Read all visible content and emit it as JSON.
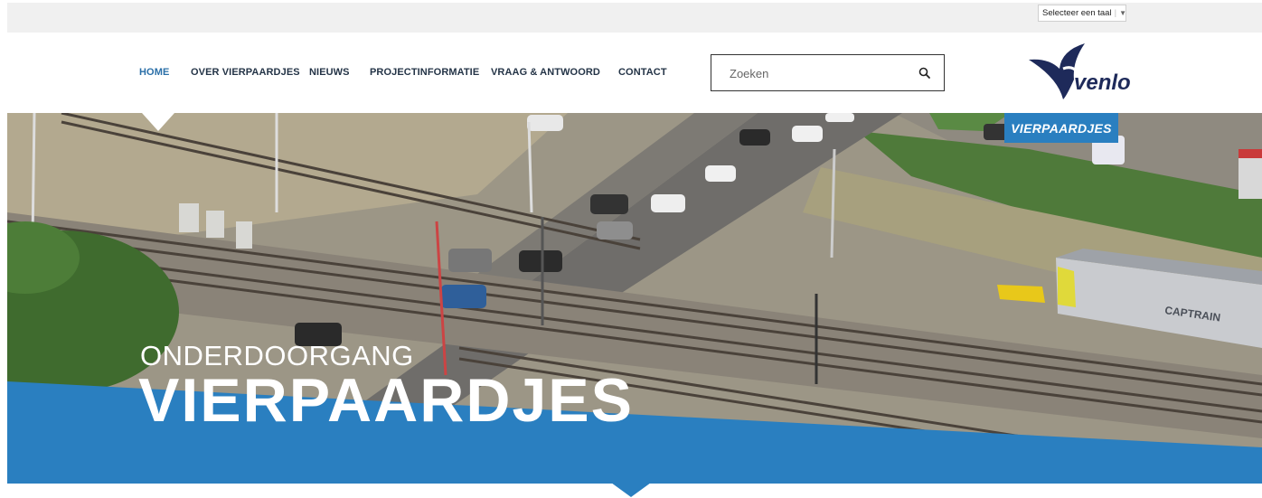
{
  "language_select": {
    "label": "Selecteer een taal",
    "sep": "|",
    "arrow": "▼"
  },
  "nav": {
    "items": [
      {
        "label": "HOME"
      },
      {
        "label": "OVER VIERPAARDJES"
      },
      {
        "label": "NIEUWS"
      },
      {
        "label": "PROJECTINFORMATIE"
      },
      {
        "label": "VRAAG & ANTWOORD"
      },
      {
        "label": "CONTACT"
      }
    ],
    "active_index": 0
  },
  "search": {
    "placeholder": "Zoeken",
    "icon": "search-icon"
  },
  "logo": {
    "text": "venlo",
    "badge": "VIERPAARDJES"
  },
  "hero": {
    "subtitle": "ONDERDOORGANG",
    "title": "VIERPAARDJES"
  },
  "colors": {
    "accent_blue": "#2a7fc0",
    "nav_active": "#2a6fa8",
    "logo_navy": "#1e2a5a"
  },
  "photo_text": {
    "train_label": "CAPTRAIN"
  }
}
